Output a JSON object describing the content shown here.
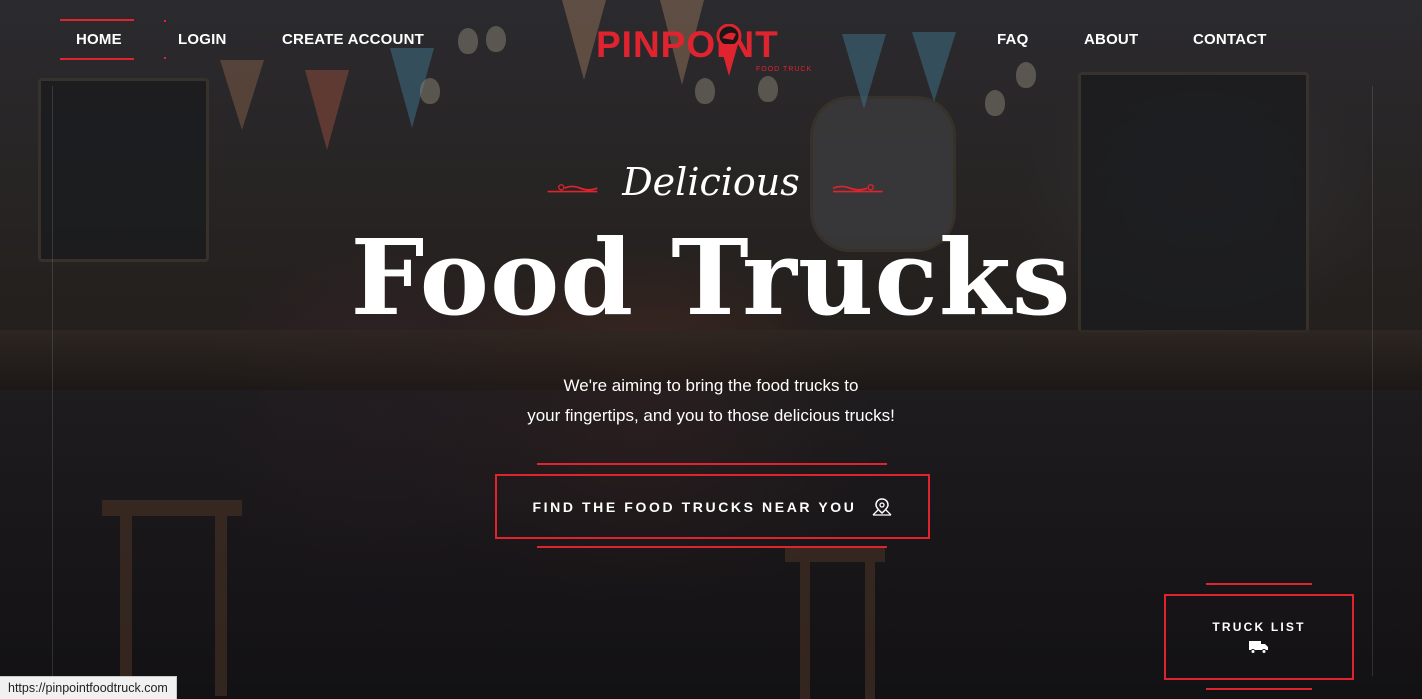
{
  "nav": {
    "left": [
      {
        "key": "home",
        "label": "HOME"
      },
      {
        "key": "login",
        "label": "LOGIN"
      },
      {
        "key": "create",
        "label": "CREATE ACCOUNT"
      }
    ],
    "right": [
      {
        "key": "faq",
        "label": "FAQ"
      },
      {
        "key": "about",
        "label": "ABOUT"
      },
      {
        "key": "contact",
        "label": "CONTACT"
      }
    ]
  },
  "logo": {
    "name": "PINPOINT",
    "sub": "FOOD TRUCK"
  },
  "hero": {
    "script_word": "Delicious",
    "title": "Food Trucks",
    "tagline_1": "We're aiming to bring the food trucks to",
    "tagline_2": "your fingertips, and you to those delicious trucks!",
    "cta_label": "FIND THE FOOD TRUCKS NEAR YOU",
    "cta_icon": "map-pin-icon"
  },
  "truck_list": {
    "label": "TRUCK LIST",
    "icon": "truck-icon"
  },
  "status_url": "https://pinpointfoodtruck.com",
  "colors": {
    "accent": "#e0242f",
    "text": "#ffffff"
  }
}
